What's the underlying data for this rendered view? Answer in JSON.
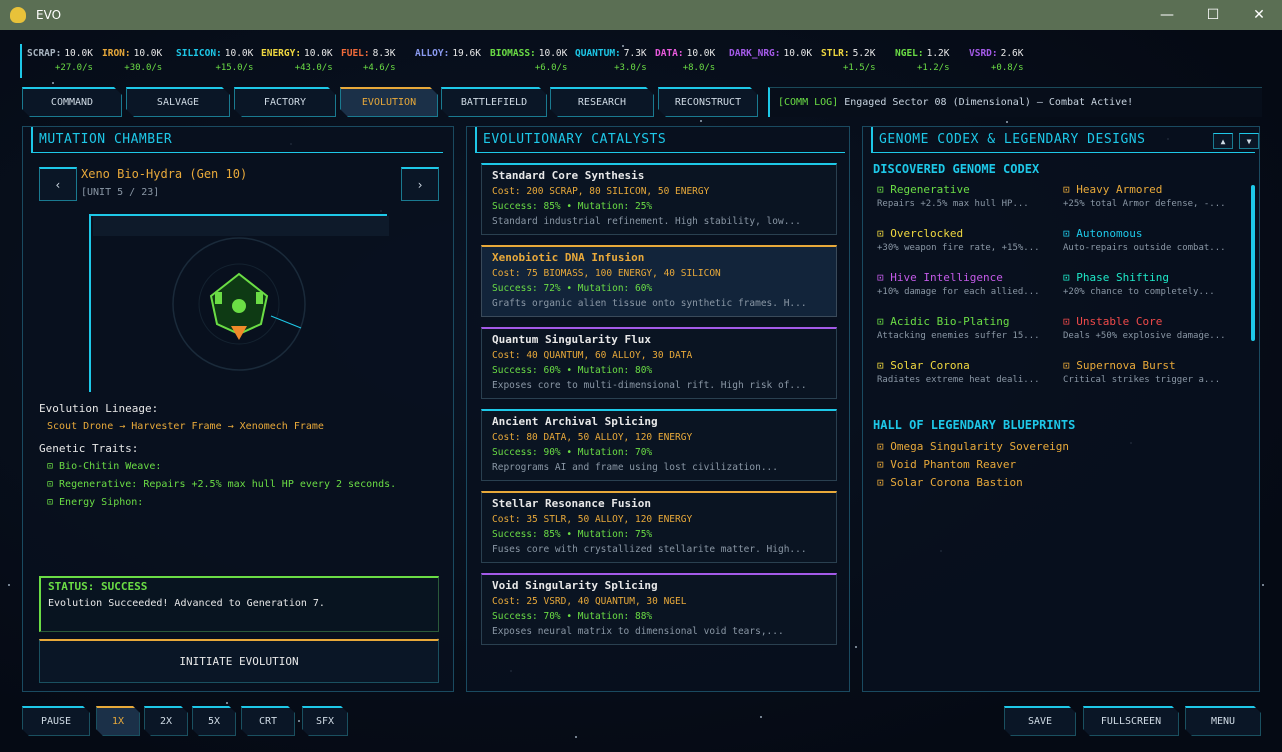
{
  "window": {
    "title": "EVO",
    "min": "—",
    "max": "☐",
    "close": "✕"
  },
  "resources": [
    {
      "label": "SCRAP:",
      "value": "10.0K",
      "rate": "+27.0/s",
      "color": "#a8b4c0"
    },
    {
      "label": "IRON:",
      "value": "10.0K",
      "rate": "+30.0/s",
      "color": "#e8a93a"
    },
    {
      "label": "SILICON:",
      "value": "10.0K",
      "rate": "+15.0/s",
      "color": "#1ec8e8"
    },
    {
      "label": "ENERGY:",
      "value": "10.0K",
      "rate": "+43.0/s",
      "color": "#f0d840"
    },
    {
      "label": "FUEL:",
      "value": "8.3K",
      "rate": "+4.6/s",
      "color": "#f06a3a"
    },
    {
      "label": "ALLOY:",
      "value": "19.6K",
      "rate": "",
      "color": "#8a9af0"
    },
    {
      "label": "BIOMASS:",
      "value": "10.0K",
      "rate": "+6.0/s",
      "color": "#6bdd45"
    },
    {
      "label": "QUANTUM:",
      "value": "7.3K",
      "rate": "+3.0/s",
      "color": "#1ec8e8"
    },
    {
      "label": "DATA:",
      "value": "10.0K",
      "rate": "+8.0/s",
      "color": "#e85adc"
    },
    {
      "label": "DARK_NRG:",
      "value": "10.0K",
      "rate": "",
      "color": "#a45ae8"
    },
    {
      "label": "STLR:",
      "value": "5.2K",
      "rate": "+1.5/s",
      "color": "#f0d840"
    },
    {
      "label": "NGEL:",
      "value": "1.2K",
      "rate": "+1.2/s",
      "color": "#6bdd45"
    },
    {
      "label": "VSRD:",
      "value": "2.6K",
      "rate": "+0.8/s",
      "color": "#a45ae8"
    }
  ],
  "tabs": [
    "COMMAND",
    "SALVAGE",
    "FACTORY",
    "EVOLUTION",
    "BATTLEFIELD",
    "RESEARCH",
    "RECONSTRUCT"
  ],
  "comm": {
    "tag": "[COMM LOG]",
    "text": "Engaged Sector 08 (Dimensional) — Combat Active!"
  },
  "mutation": {
    "title": "MUTATION CHAMBER",
    "prev": "‹",
    "next": "›",
    "unit_name": "Xeno Bio-Hydra (Gen 10)",
    "unit_index": "[UNIT 5 / 23]",
    "lineage_heading": "Evolution Lineage:",
    "lineage": "Scout Drone → Harvester Frame → Xenomech Frame",
    "traits_heading": "Genetic Traits:",
    "traits": [
      "⊡ Bio-Chitin Weave:",
      "⊡ Regenerative: Repairs +2.5% max hull HP every 2 seconds.",
      "⊡ Energy Siphon:"
    ],
    "status_title": "STATUS: SUCCESS",
    "status_msg": "Evolution Succeeded! Advanced to Generation 7.",
    "initiate": "INITIATE EVOLUTION"
  },
  "catalysts": {
    "title": "EVOLUTIONARY CATALYSTS",
    "items": [
      {
        "name": "Standard Core Synthesis",
        "cost": "Cost: 200 SCRAP, 80 SILICON, 50 ENERGY",
        "success": "Success: 85%  •  Mutation: 25%",
        "desc": "Standard industrial refinement. High stability, low...",
        "accent": "#1ec8e8"
      },
      {
        "name": "Xenobiotic DNA Infusion",
        "cost": "Cost: 75 BIOMASS, 100 ENERGY, 40 SILICON",
        "success": "Success: 72%  •  Mutation: 60%",
        "desc": "Grafts organic alien tissue onto synthetic frames. H...",
        "accent": "#e8a93a"
      },
      {
        "name": "Quantum Singularity Flux",
        "cost": "Cost: 40 QUANTUM, 60 ALLOY, 30 DATA",
        "success": "Success: 60%  •  Mutation: 80%",
        "desc": "Exposes core to multi-dimensional rift. High risk of...",
        "accent": "#a45ae8"
      },
      {
        "name": "Ancient Archival Splicing",
        "cost": "Cost: 80 DATA, 50 ALLOY, 120 ENERGY",
        "success": "Success: 90%  •  Mutation: 70%",
        "desc": "Reprograms AI and frame using lost civilization...",
        "accent": "#1ec8e8"
      },
      {
        "name": "Stellar Resonance Fusion",
        "cost": "Cost: 35 STLR, 50 ALLOY, 120 ENERGY",
        "success": "Success: 85%  •  Mutation: 75%",
        "desc": "Fuses core with crystallized stellarite matter. High...",
        "accent": "#e8a93a"
      },
      {
        "name": "Void Singularity Splicing",
        "cost": "Cost: 25 VSRD, 40 QUANTUM, 30 NGEL",
        "success": "Success: 70%  •  Mutation: 88%",
        "desc": "Exposes neural matrix to dimensional void tears,...",
        "accent": "#a45ae8"
      }
    ]
  },
  "genome": {
    "title": "GENOME CODEX & LEGENDARY DESIGNS",
    "codex_heading": "DISCOVERED GENOME CODEX",
    "scroll_up": "▲",
    "scroll_down": "▼",
    "genes": [
      {
        "name": "⊡ Regenerative",
        "desc": "Repairs +2.5% max hull HP...",
        "color": "#6bdd45"
      },
      {
        "name": "⊡ Heavy Armored",
        "desc": "+25% total Armor defense, -...",
        "color": "#e8a93a"
      },
      {
        "name": "⊡ Overclocked",
        "desc": "+30% weapon fire rate, +15%...",
        "color": "#f0d840"
      },
      {
        "name": "⊡ Autonomous",
        "desc": "Auto-repairs outside combat...",
        "color": "#1ec8e8"
      },
      {
        "name": "⊡ Hive Intelligence",
        "desc": "+10% damage for each allied...",
        "color": "#c45ae8"
      },
      {
        "name": "⊡ Phase Shifting",
        "desc": "+20% chance to completely...",
        "color": "#1ee8c8"
      },
      {
        "name": "⊡ Acidic Bio-Plating",
        "desc": "Attacking enemies suffer 15...",
        "color": "#6bdd45"
      },
      {
        "name": "⊡ Unstable Core",
        "desc": "Deals +50% explosive damage...",
        "color": "#f04a4a"
      },
      {
        "name": "⊡ Solar Corona",
        "desc": "Radiates extreme heat deali...",
        "color": "#f0d840"
      },
      {
        "name": "⊡ Supernova Burst",
        "desc": "Critical strikes trigger a...",
        "color": "#e8a93a"
      }
    ],
    "legendary_heading": "HALL OF LEGENDARY BLUEPRINTS",
    "legendary": [
      "⊡ Omega Singularity Sovereign",
      "⊡ Void Phantom Reaver",
      "⊡ Solar Corona Bastion"
    ]
  },
  "controls": {
    "left": [
      "PAUSE",
      "1X",
      "2X",
      "5X",
      "CRT",
      "SFX"
    ],
    "active": "1X",
    "right": [
      "SAVE",
      "FULLSCREEN",
      "MENU"
    ]
  }
}
